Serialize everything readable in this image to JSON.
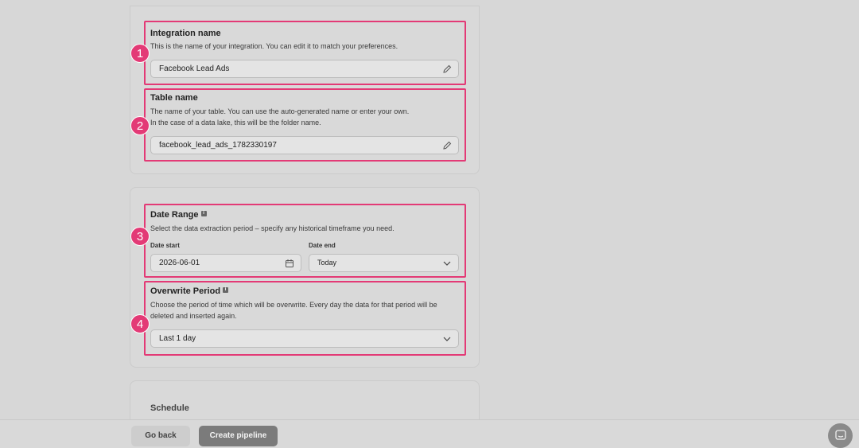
{
  "sections": {
    "integration": {
      "badge": "1",
      "title": "Integration name",
      "description": "This is the name of your integration. You can edit it to match your preferences.",
      "value": "Facebook Lead Ads",
      "icon": "pencil-icon"
    },
    "table": {
      "badge": "2",
      "title": "Table name",
      "description_line1": "The name of your table. You can use the auto-generated name or enter your own.",
      "description_line2": "In the case of a data lake, this will be the folder name.",
      "value": "facebook_lead_ads_1782330197",
      "icon": "pencil-icon"
    },
    "date_range": {
      "badge": "3",
      "title": "Date Range",
      "info_icon": "i",
      "description": "Select the data extraction period – specify any historical timeframe you need.",
      "start_label": "Date start",
      "start_value": "2026-06-01",
      "end_label": "Date end",
      "end_value": "Today"
    },
    "overwrite": {
      "badge": "4",
      "title": "Overwrite Period",
      "info_icon": "i",
      "description_line1": "Choose the period of time which will be overwrite. Every day the data for that period will be",
      "description_line2": "deleted and inserted again.",
      "value": "Last 1 day"
    },
    "schedule": {
      "title": "Schedule"
    }
  },
  "footer": {
    "back_label": "Go back",
    "create_label": "Create pipeline"
  },
  "colors": {
    "highlight": "#e33a76",
    "background": "#d7d7d7"
  }
}
